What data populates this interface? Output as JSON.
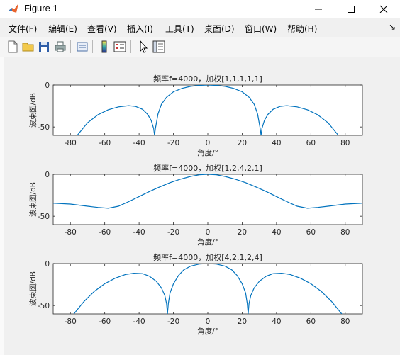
{
  "window": {
    "title": "Figure 1"
  },
  "menu": [
    {
      "label": "文件(F)"
    },
    {
      "label": "编辑(E)"
    },
    {
      "label": "查看(V)"
    },
    {
      "label": "插入(I)"
    },
    {
      "label": "工具(T)"
    },
    {
      "label": "桌面(D)"
    },
    {
      "label": "窗口(W)"
    },
    {
      "label": "帮助(H)"
    }
  ],
  "toolbar_icons": [
    "new-file-icon",
    "open-folder-icon",
    "save-icon",
    "print-icon",
    "print-preview-icon",
    "colorbar-icon",
    "legend-icon",
    "pointer-icon",
    "property-editor-icon"
  ],
  "colors": {
    "line": "#0072bd"
  },
  "chart_data": [
    {
      "type": "line",
      "title": "频率f=4000，加权[1,1,1,1,1]",
      "xlabel": "角度/°",
      "ylabel": "波束图/dB",
      "xlim": [
        -90,
        90
      ],
      "ylim": [
        -60,
        0
      ],
      "xticks": [
        -80,
        -60,
        -40,
        -20,
        0,
        20,
        40,
        60,
        80
      ],
      "yticks": [
        0,
        -50
      ],
      "weights": [
        1,
        1,
        1,
        1,
        1
      ],
      "series": [
        {
          "x": [
            -76,
            -70,
            -64,
            -58,
            -52,
            -46,
            -42,
            -38,
            -35,
            -33,
            -31.5,
            -31,
            -30.5,
            -29,
            -27,
            -24,
            -20,
            -15,
            -10,
            -5,
            0,
            5,
            10,
            15,
            20,
            24,
            27,
            29,
            30.5,
            31,
            31.5,
            33,
            35,
            38,
            42,
            46,
            52,
            58,
            64,
            70,
            76
          ],
          "y": [
            -60,
            -45,
            -35.5,
            -29.5,
            -26,
            -24.6,
            -25.5,
            -29,
            -35,
            -42,
            -52,
            -60,
            -52,
            -34.5,
            -23,
            -14.5,
            -8,
            -4,
            -1.6,
            -0.4,
            0,
            -0.4,
            -1.6,
            -4,
            -8,
            -14.5,
            -23,
            -34.5,
            -52,
            -60,
            -52,
            -42,
            -35,
            -29,
            -25.5,
            -24.6,
            -26,
            -29.5,
            -35.5,
            -45,
            -60
          ]
        }
      ]
    },
    {
      "type": "line",
      "title": "频率f=4000，加权[1,2,4,2,1]",
      "xlabel": "角度/°",
      "ylabel": "波束图/dB",
      "xlim": [
        -90,
        90
      ],
      "ylim": [
        -60,
        0
      ],
      "xticks": [
        -80,
        -60,
        -40,
        -20,
        0,
        20,
        40,
        60,
        80
      ],
      "yticks": [
        0,
        -50
      ],
      "weights": [
        1,
        2,
        4,
        2,
        1
      ],
      "series": [
        {
          "x": [
            -90,
            -80,
            -70,
            -64,
            -58,
            -52,
            -46,
            -40,
            -34,
            -28,
            -22,
            -16,
            -10,
            -5,
            0,
            5,
            10,
            16,
            22,
            28,
            34,
            40,
            46,
            52,
            58,
            64,
            70,
            80,
            90
          ],
          "y": [
            -34.5,
            -35.5,
            -38,
            -39.5,
            -40.5,
            -38,
            -32.5,
            -26.5,
            -20.5,
            -15,
            -10,
            -5.8,
            -2.5,
            -0.6,
            0,
            -0.6,
            -2.5,
            -5.8,
            -10,
            -15,
            -20.5,
            -26.5,
            -32.5,
            -38,
            -40.5,
            -39.5,
            -38,
            -35.5,
            -34.5
          ]
        }
      ]
    },
    {
      "type": "line",
      "title": "频率f=4000，加权[4,2,1,2,4]",
      "xlabel": "角度/°",
      "ylabel": "波束图/dB",
      "xlim": [
        -90,
        90
      ],
      "ylim": [
        -60,
        0
      ],
      "xticks": [
        -80,
        -60,
        -40,
        -20,
        0,
        20,
        40,
        60,
        80
      ],
      "yticks": [
        0,
        -50
      ],
      "weights": [
        4,
        2,
        1,
        2,
        4
      ],
      "series": [
        {
          "x": [
            -78,
            -72,
            -66,
            -60,
            -54,
            -48,
            -43,
            -38,
            -34,
            -30,
            -27,
            -25,
            -24,
            -23.5,
            -23,
            -22,
            -20,
            -17,
            -14,
            -10,
            -5,
            0,
            5,
            10,
            14,
            17,
            20,
            22,
            23,
            23.5,
            24,
            25,
            27,
            30,
            34,
            38,
            43,
            48,
            54,
            60,
            66,
            72,
            78
          ],
          "y": [
            -60,
            -45,
            -33,
            -24,
            -17.5,
            -13,
            -11.5,
            -12,
            -15,
            -21,
            -29,
            -38,
            -48,
            -60,
            -48,
            -35,
            -24,
            -14,
            -7.5,
            -3,
            -0.6,
            0,
            -0.6,
            -3,
            -7.5,
            -14,
            -24,
            -35,
            -48,
            -60,
            -48,
            -38,
            -29,
            -21,
            -15,
            -12,
            -11.5,
            -13,
            -17.5,
            -24,
            -33,
            -45,
            -60
          ]
        }
      ]
    }
  ]
}
